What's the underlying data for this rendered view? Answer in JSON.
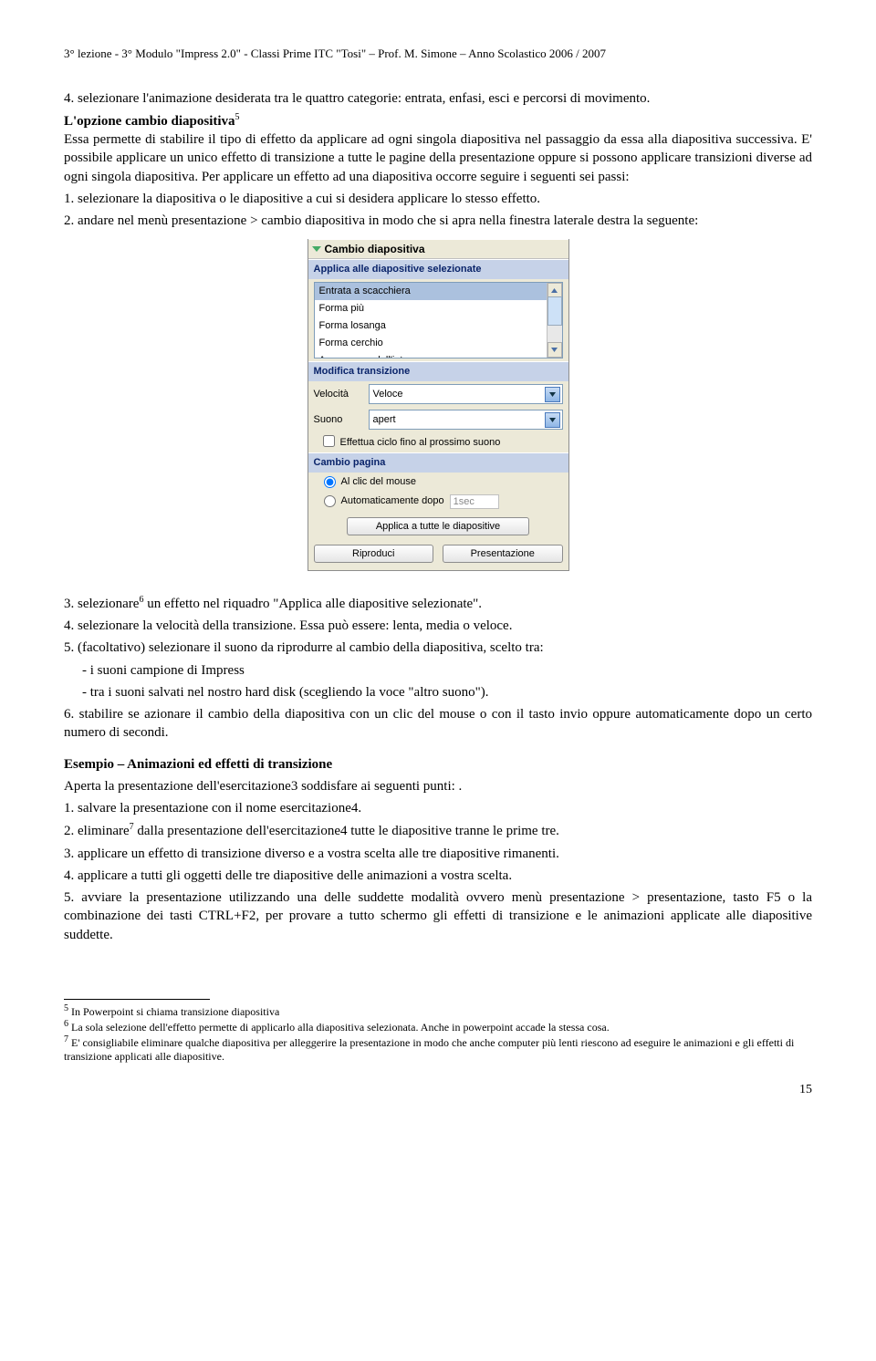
{
  "header": "3° lezione - 3° Modulo \"Impress 2.0\" - Classi Prime ITC \"Tosi\" – Prof.  M. Simone – Anno Scolastico 2006 / 2007",
  "para1": "4. selezionare l'animazione desiderata tra le quattro categorie: entrata, enfasi, esci e percorsi di movimento.",
  "h1": "L'opzione cambio diapositiva",
  "h1_sup": "5",
  "para2a": "Essa permette di stabilire il tipo di effetto da applicare ad ogni singola diapositiva nel passaggio da essa alla diapositiva successiva. E' possibile applicare un unico effetto di transizione a tutte le pagine della presentazione oppure si possono applicare transizioni diverse ad ogni singola diapositiva. Per applicare un effetto ad una diapositiva occorre seguire i seguenti sei passi:",
  "para2b": "1. selezionare la diapositiva o le diapositive a cui si desidera applicare lo stesso effetto.",
  "para2c": "2. andare nel menù presentazione > cambio diapositiva in modo che si apra nella finestra laterale destra la seguente:",
  "panel": {
    "title": "Cambio diapositiva",
    "section1": "Applica alle diapositive selezionate",
    "list": [
      "Entrata a scacchiera",
      "Forma più",
      "Forma losanga",
      "Forma cerchio",
      "A comparsa dall'interno"
    ],
    "section2": "Modifica transizione",
    "speed_label": "Velocità",
    "speed_value": "Veloce",
    "sound_label": "Suono",
    "sound_value": "apert",
    "loop_check": "Effettua ciclo fino al prossimo suono",
    "section3": "Cambio pagina",
    "radio1": "Al clic del mouse",
    "radio2": "Automaticamente dopo",
    "radio2_val": "1sec",
    "btn_apply_all": "Applica a tutte le diapositive",
    "btn_play": "Riproduci",
    "btn_present": "Presentazione"
  },
  "para3": "3. selezionare",
  "para3_sup": "6",
  "para3b": " un effetto nel riquadro \"Applica alle diapositive selezionate\".",
  "para4": "4. selezionare la velocità della transizione. Essa può essere: lenta, media o veloce.",
  "para5": "5. (facoltativo) selezionare il suono da riprodurre al cambio della diapositiva, scelto tra:",
  "para5a": "- i suoni campione di Impress",
  "para5b": "- tra i suoni salvati nel nostro hard disk (scegliendo la voce \"altro suono\").",
  "para6": "6. stabilire se azionare il cambio della diapositiva con un clic del mouse o con il tasto invio oppure automaticamente dopo un certo numero di secondi.",
  "ex_title": "Esempio – Animazioni ed effetti di transizione",
  "ex1": "Aperta la presentazione dell'esercitazione3 soddisfare ai seguenti punti:      .",
  "ex2": "1. salvare la presentazione con il nome esercitazione4.",
  "ex3a": "2. eliminare",
  "ex3_sup": "7",
  "ex3b": " dalla presentazione dell'esercitazione4 tutte le diapositive tranne le prime tre.",
  "ex4": "3. applicare un effetto di transizione diverso e a vostra scelta alle tre diapositive rimanenti.",
  "ex5": "4. applicare a tutti gli oggetti delle tre diapositive delle animazioni a vostra scelta.",
  "ex6": "5. avviare la presentazione utilizzando una delle suddette modalità  ovvero menù presentazione > presentazione, tasto F5 o la combinazione dei tasti CTRL+F2, per provare a tutto schermo gli effetti di transizione e le animazioni applicate alle diapositive suddette.",
  "fn5": " In Powerpoint si chiama transizione diapositiva",
  "fn6": " La sola selezione dell'effetto permette di applicarlo alla diapositiva selezionata. Anche in powerpoint accade la stessa cosa.",
  "fn7": " E' consigliabile eliminare qualche diapositiva per alleggerire la presentazione in modo che anche computer più lenti riescono ad eseguire le animazioni e gli effetti di transizione applicati alle diapositive.",
  "page_num": "15"
}
